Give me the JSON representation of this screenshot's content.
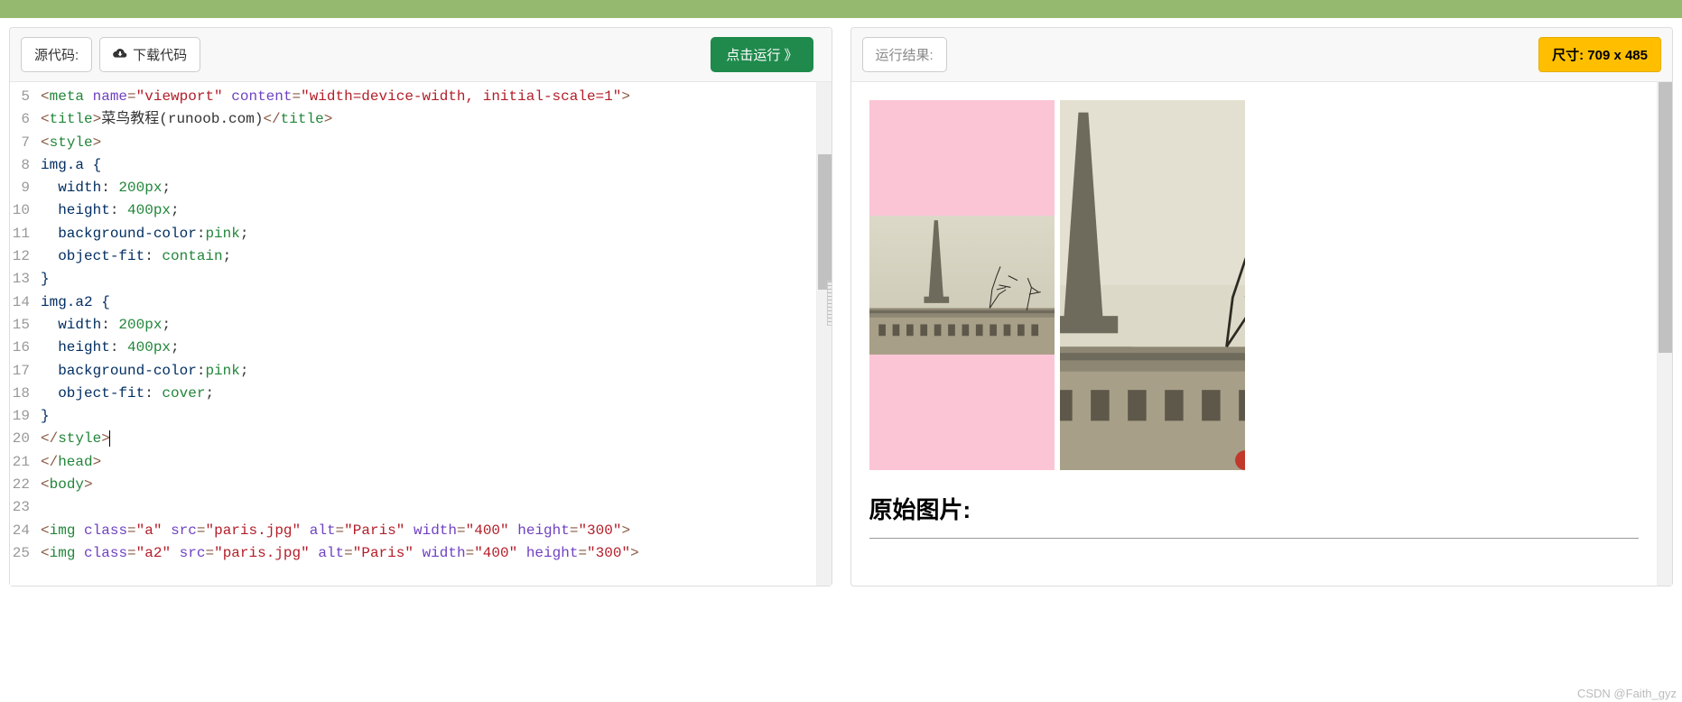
{
  "left": {
    "source_label": "源代码:",
    "download_label": "下载代码",
    "run_label": "点击运行 》",
    "lines_start": 5,
    "code": [
      {
        "type": "tag",
        "raw": [
          {
            "c": "t-punct",
            "t": "<"
          },
          {
            "c": "t-tag",
            "t": "meta"
          },
          {
            "c": "",
            "t": " "
          },
          {
            "c": "t-attr",
            "t": "name"
          },
          {
            "c": "t-punct",
            "t": "="
          },
          {
            "c": "t-str",
            "t": "\"viewport\""
          },
          {
            "c": "",
            "t": " "
          },
          {
            "c": "t-attr",
            "t": "content"
          },
          {
            "c": "t-punct",
            "t": "="
          },
          {
            "c": "t-str",
            "t": "\"width=device-width, initial-scale=1\""
          },
          {
            "c": "t-punct",
            "t": ">"
          }
        ]
      },
      {
        "type": "tag",
        "raw": [
          {
            "c": "t-punct",
            "t": "<"
          },
          {
            "c": "t-tag",
            "t": "title"
          },
          {
            "c": "t-punct",
            "t": ">"
          },
          {
            "c": "t-text",
            "t": "菜鸟教程(runoob.com)"
          },
          {
            "c": "t-punct",
            "t": "</"
          },
          {
            "c": "t-tag",
            "t": "title"
          },
          {
            "c": "t-punct",
            "t": ">"
          }
        ]
      },
      {
        "type": "tag",
        "raw": [
          {
            "c": "t-punct",
            "t": "<"
          },
          {
            "c": "t-tag",
            "t": "style"
          },
          {
            "c": "t-punct",
            "t": ">"
          }
        ]
      },
      {
        "type": "css",
        "raw": [
          {
            "c": "t-prop",
            "t": "img.a {"
          }
        ]
      },
      {
        "type": "css",
        "raw": [
          {
            "c": "",
            "t": "  "
          },
          {
            "c": "t-prop",
            "t": "width"
          },
          {
            "c": "t-text",
            "t": ": "
          },
          {
            "c": "t-val",
            "t": "200px"
          },
          {
            "c": "t-text",
            "t": ";"
          }
        ]
      },
      {
        "type": "css",
        "raw": [
          {
            "c": "",
            "t": "  "
          },
          {
            "c": "t-prop",
            "t": "height"
          },
          {
            "c": "t-text",
            "t": ": "
          },
          {
            "c": "t-val",
            "t": "400px"
          },
          {
            "c": "t-text",
            "t": ";"
          }
        ]
      },
      {
        "type": "css",
        "raw": [
          {
            "c": "",
            "t": "  "
          },
          {
            "c": "t-prop",
            "t": "background-color"
          },
          {
            "c": "t-text",
            "t": ":"
          },
          {
            "c": "t-val",
            "t": "pink"
          },
          {
            "c": "t-text",
            "t": ";"
          }
        ]
      },
      {
        "type": "css",
        "raw": [
          {
            "c": "",
            "t": "  "
          },
          {
            "c": "t-prop",
            "t": "object-fit"
          },
          {
            "c": "t-text",
            "t": ": "
          },
          {
            "c": "t-val",
            "t": "contain"
          },
          {
            "c": "t-text",
            "t": ";"
          }
        ]
      },
      {
        "type": "css",
        "raw": [
          {
            "c": "t-prop",
            "t": "}"
          }
        ]
      },
      {
        "type": "css",
        "raw": [
          {
            "c": "t-prop",
            "t": "img.a2 {"
          }
        ]
      },
      {
        "type": "css",
        "raw": [
          {
            "c": "",
            "t": "  "
          },
          {
            "c": "t-prop",
            "t": "width"
          },
          {
            "c": "t-text",
            "t": ": "
          },
          {
            "c": "t-val",
            "t": "200px"
          },
          {
            "c": "t-text",
            "t": ";"
          }
        ]
      },
      {
        "type": "css",
        "raw": [
          {
            "c": "",
            "t": "  "
          },
          {
            "c": "t-prop",
            "t": "height"
          },
          {
            "c": "t-text",
            "t": ": "
          },
          {
            "c": "t-val",
            "t": "400px"
          },
          {
            "c": "t-text",
            "t": ";"
          }
        ]
      },
      {
        "type": "css",
        "raw": [
          {
            "c": "",
            "t": "  "
          },
          {
            "c": "t-prop",
            "t": "background-color"
          },
          {
            "c": "t-text",
            "t": ":"
          },
          {
            "c": "t-val",
            "t": "pink"
          },
          {
            "c": "t-text",
            "t": ";"
          }
        ]
      },
      {
        "type": "css",
        "raw": [
          {
            "c": "",
            "t": "  "
          },
          {
            "c": "t-prop",
            "t": "object-fit"
          },
          {
            "c": "t-text",
            "t": ": "
          },
          {
            "c": "t-val",
            "t": "cover"
          },
          {
            "c": "t-text",
            "t": ";"
          }
        ]
      },
      {
        "type": "css",
        "raw": [
          {
            "c": "t-prop",
            "t": "}"
          }
        ]
      },
      {
        "type": "tag",
        "cursor": true,
        "raw": [
          {
            "c": "t-punct",
            "t": "</"
          },
          {
            "c": "t-tag",
            "t": "style"
          },
          {
            "c": "t-punct",
            "t": ">"
          }
        ]
      },
      {
        "type": "tag",
        "raw": [
          {
            "c": "t-punct",
            "t": "</"
          },
          {
            "c": "t-tag",
            "t": "head"
          },
          {
            "c": "t-punct",
            "t": ">"
          }
        ]
      },
      {
        "type": "tag",
        "raw": [
          {
            "c": "t-punct",
            "t": "<"
          },
          {
            "c": "t-tag",
            "t": "body"
          },
          {
            "c": "t-punct",
            "t": ">"
          }
        ]
      },
      {
        "type": "blank",
        "raw": []
      },
      {
        "type": "tag",
        "raw": [
          {
            "c": "t-punct",
            "t": "<"
          },
          {
            "c": "t-tag",
            "t": "img"
          },
          {
            "c": "",
            "t": " "
          },
          {
            "c": "t-attr",
            "t": "class"
          },
          {
            "c": "t-punct",
            "t": "="
          },
          {
            "c": "t-str",
            "t": "\"a\""
          },
          {
            "c": "",
            "t": " "
          },
          {
            "c": "t-attr",
            "t": "src"
          },
          {
            "c": "t-punct",
            "t": "="
          },
          {
            "c": "t-str",
            "t": "\"paris.jpg\""
          },
          {
            "c": "",
            "t": " "
          },
          {
            "c": "t-attr",
            "t": "alt"
          },
          {
            "c": "t-punct",
            "t": "="
          },
          {
            "c": "t-str",
            "t": "\"Paris\""
          },
          {
            "c": "",
            "t": " "
          },
          {
            "c": "t-attr",
            "t": "width"
          },
          {
            "c": "t-punct",
            "t": "="
          },
          {
            "c": "t-str",
            "t": "\"400\""
          },
          {
            "c": "",
            "t": " "
          },
          {
            "c": "t-attr",
            "t": "height"
          },
          {
            "c": "t-punct",
            "t": "="
          },
          {
            "c": "t-str",
            "t": "\"300\""
          },
          {
            "c": "t-punct",
            "t": ">"
          }
        ]
      },
      {
        "type": "tag",
        "raw": [
          {
            "c": "t-punct",
            "t": "<"
          },
          {
            "c": "t-tag",
            "t": "img"
          },
          {
            "c": "",
            "t": " "
          },
          {
            "c": "t-attr",
            "t": "class"
          },
          {
            "c": "t-punct",
            "t": "="
          },
          {
            "c": "t-str",
            "t": "\"a2\""
          },
          {
            "c": "",
            "t": " "
          },
          {
            "c": "t-attr",
            "t": "src"
          },
          {
            "c": "t-punct",
            "t": "="
          },
          {
            "c": "t-str",
            "t": "\"paris.jpg\""
          },
          {
            "c": "",
            "t": " "
          },
          {
            "c": "t-attr",
            "t": "alt"
          },
          {
            "c": "t-punct",
            "t": "="
          },
          {
            "c": "t-str",
            "t": "\"Paris\""
          },
          {
            "c": "",
            "t": " "
          },
          {
            "c": "t-attr",
            "t": "width"
          },
          {
            "c": "t-punct",
            "t": "="
          },
          {
            "c": "t-str",
            "t": "\"400\""
          },
          {
            "c": "",
            "t": " "
          },
          {
            "c": "t-attr",
            "t": "height"
          },
          {
            "c": "t-punct",
            "t": "="
          },
          {
            "c": "t-str",
            "t": "\"300\""
          },
          {
            "c": "t-punct",
            "t": ">"
          }
        ]
      }
    ]
  },
  "right": {
    "result_label": "运行结果:",
    "size_label": "尺寸: 709 x 485",
    "heading": "原始图片:"
  },
  "watermark": "CSDN @Faith_gyz"
}
